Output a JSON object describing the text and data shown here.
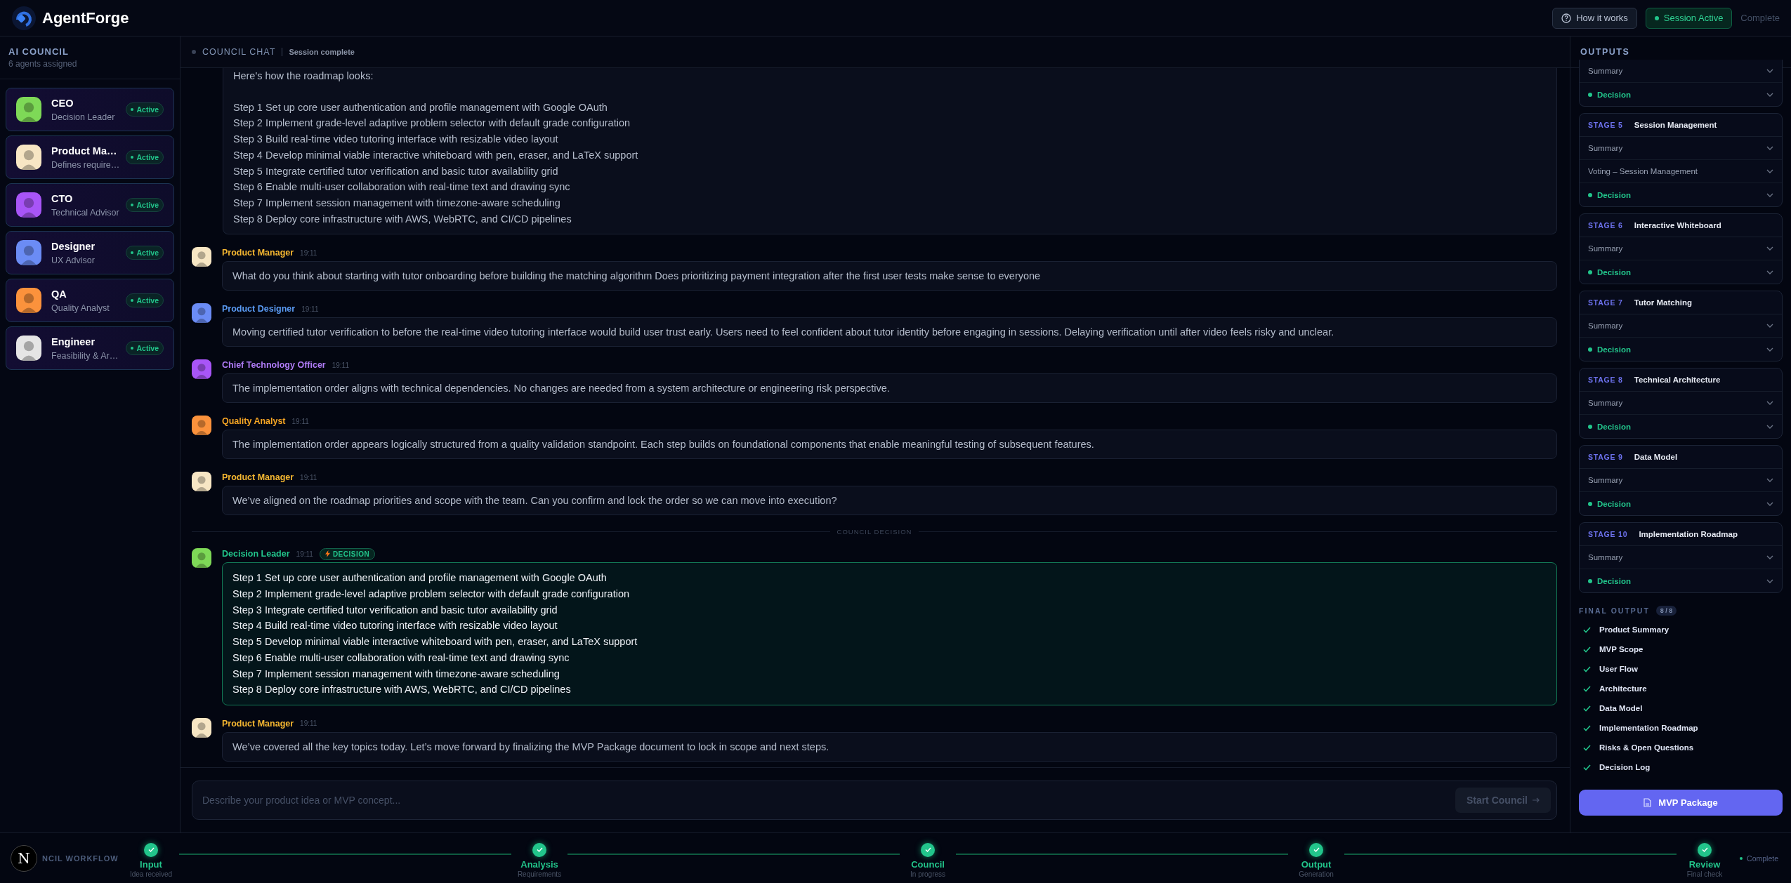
{
  "header": {
    "brand": "AgentForge",
    "help_button": "How it works",
    "session_badge": "Session Active",
    "status": "Complete"
  },
  "sidebar": {
    "title": "AI COUNCIL",
    "subtitle": "6 agents assigned",
    "agents": [
      {
        "name": "CEO",
        "role": "Decision Leader",
        "status": "Active",
        "color": "#7ed957"
      },
      {
        "name": "Product Ma…",
        "role": "Defines require…",
        "status": "Active",
        "color": "#f7e6c4"
      },
      {
        "name": "CTO",
        "role": "Technical Advisor",
        "status": "Active",
        "color": "#a855f7"
      },
      {
        "name": "Designer",
        "role": "UX Advisor",
        "status": "Active",
        "color": "#6b8cf5"
      },
      {
        "name": "QA",
        "role": "Quality Analyst",
        "status": "Active",
        "color": "#fb923c"
      },
      {
        "name": "Engineer",
        "role": "Feasibility & Ar…",
        "status": "Active",
        "color": "#e5e5e5"
      }
    ]
  },
  "chat": {
    "title": "COUNCIL CHAT",
    "status": "Session complete",
    "messages": [
      {
        "kind": "continuation",
        "intro": "Here's how the roadmap looks:",
        "steps": [
          "Step 1 Set up core user authentication and profile management with Google OAuth",
          "Step 2 Implement grade-level adaptive problem selector with default grade configuration",
          "Step 3 Build real-time video tutoring interface with resizable video layout",
          "Step 4 Develop minimal viable interactive whiteboard with pen, eraser, and LaTeX support",
          "Step 5 Integrate certified tutor verification and basic tutor availability grid",
          "Step 6 Enable multi-user collaboration with real-time text and drawing sync",
          "Step 7 Implement session management with timezone-aware scheduling",
          "Step 8 Deploy core infrastructure with AWS, WebRTC, and CI/CD pipelines"
        ]
      },
      {
        "kind": "message",
        "author": "Product Manager",
        "color": "#f5b731",
        "avatar": {
          "color": "#f7e6c4"
        },
        "time": "19:11",
        "text": "What do you think about starting with tutor onboarding before building the matching algorithm Does prioritizing payment integration after the first user tests make sense to everyone"
      },
      {
        "kind": "message",
        "author": "Product Designer",
        "color": "#5b9cf5",
        "avatar": {
          "color": "#6b8cf5"
        },
        "time": "19:11",
        "text": "Moving certified tutor verification to before the real-time video tutoring interface would build user trust early. Users need to feel confident about tutor identity before engaging in sessions. Delaying verification until after video feels risky and unclear."
      },
      {
        "kind": "message",
        "author": "Chief Technology Officer",
        "color": "#b07cf7",
        "avatar": {
          "color": "#a855f7"
        },
        "time": "19:11",
        "text": "The implementation order aligns with technical dependencies. No changes are needed from a system architecture or engineering risk perspective."
      },
      {
        "kind": "message",
        "author": "Quality Analyst",
        "color": "#f5a524",
        "avatar": {
          "color": "#fb923c"
        },
        "time": "19:11",
        "text": "The implementation order appears logically structured from a quality validation standpoint. Each step builds on foundational components that enable meaningful testing of subsequent features."
      },
      {
        "kind": "message",
        "author": "Product Manager",
        "color": "#f5b731",
        "avatar": {
          "color": "#f7e6c4"
        },
        "time": "19:11",
        "text": "We’ve aligned on the roadmap priorities and scope with the team. Can you confirm and lock the order so we can move into execution?"
      },
      {
        "kind": "divider",
        "label": "COUNCIL DECISION"
      },
      {
        "kind": "decision",
        "author": "Decision Leader",
        "color": "#22c58b",
        "avatar": {
          "color": "#7ed957"
        },
        "time": "19:11",
        "badge": "DECISION",
        "steps": [
          "Step 1 Set up core user authentication and profile management with Google OAuth",
          "Step 2 Implement grade-level adaptive problem selector with default grade configuration",
          "Step 3 Integrate certified tutor verification and basic tutor availability grid",
          "Step 4 Build real-time video tutoring interface with resizable video layout",
          "Step 5 Develop minimal viable interactive whiteboard with pen, eraser, and LaTeX support",
          "Step 6 Enable multi-user collaboration with real-time text and drawing sync",
          "Step 7 Implement session management with timezone-aware scheduling",
          "Step 8 Deploy core infrastructure with AWS, WebRTC, and CI/CD pipelines"
        ]
      },
      {
        "kind": "message",
        "author": "Product Manager",
        "color": "#f5b731",
        "avatar": {
          "color": "#f7e6c4"
        },
        "time": "19:11",
        "text": "We’ve covered all the key topics today. Let’s move forward by finalizing the MVP Package document to lock in scope and next steps."
      }
    ],
    "input": {
      "placeholder": "Describe your product idea or MVP concept...",
      "button": "Start Council",
      "disabled": true
    }
  },
  "outputs": {
    "title": "OUTPUTS",
    "stages": [
      {
        "rows": [
          {
            "kind": "summary",
            "text": "Summary"
          },
          {
            "kind": "decision",
            "text": "Decision"
          }
        ]
      },
      {
        "label": "STAGE 5",
        "title": "Session Management",
        "rows": [
          {
            "kind": "summary",
            "text": "Summary"
          },
          {
            "kind": "summary",
            "text": "Voting – Session Management"
          },
          {
            "kind": "decision",
            "text": "Decision"
          }
        ]
      },
      {
        "label": "STAGE 6",
        "title": "Interactive Whiteboard",
        "rows": [
          {
            "kind": "summary",
            "text": "Summary"
          },
          {
            "kind": "decision",
            "text": "Decision"
          }
        ]
      },
      {
        "label": "STAGE 7",
        "title": "Tutor Matching",
        "rows": [
          {
            "kind": "summary",
            "text": "Summary"
          },
          {
            "kind": "decision",
            "text": "Decision"
          }
        ]
      },
      {
        "label": "STAGE 8",
        "title": "Technical Architecture",
        "rows": [
          {
            "kind": "summary",
            "text": "Summary"
          },
          {
            "kind": "decision",
            "text": "Decision"
          }
        ]
      },
      {
        "label": "STAGE 9",
        "title": "Data Model",
        "rows": [
          {
            "kind": "summary",
            "text": "Summary"
          },
          {
            "kind": "decision",
            "text": "Decision"
          }
        ]
      },
      {
        "label": "STAGE 10",
        "title": "Implementation Roadmap",
        "rows": [
          {
            "kind": "summary",
            "text": "Summary"
          },
          {
            "kind": "decision",
            "text": "Decision"
          }
        ]
      }
    ],
    "final_output": {
      "title": "FINAL OUTPUT",
      "count": "8 / 8",
      "items": [
        {
          "text": "Product Summary",
          "checked": true
        },
        {
          "text": "MVP Scope",
          "checked": true
        },
        {
          "text": "User Flow",
          "checked": true
        },
        {
          "text": "Architecture",
          "checked": true
        },
        {
          "text": "Data Model",
          "checked": true
        },
        {
          "text": "Implementation Roadmap",
          "checked": true
        },
        {
          "text": "Risks & Open Questions",
          "checked": true
        },
        {
          "text": "Decision Log",
          "checked": true
        }
      ],
      "button": "MVP Package"
    }
  },
  "workflow": {
    "dev_badge": "N",
    "label": "NCIL WORKFLOW",
    "steps": [
      {
        "title": "Input",
        "subtitle": "Idea received",
        "done": true
      },
      {
        "title": "Analysis",
        "subtitle": "Requirements",
        "done": true
      },
      {
        "title": "Council",
        "subtitle": "In progress",
        "done": true
      },
      {
        "title": "Output",
        "subtitle": "Generation",
        "done": true
      },
      {
        "title": "Review",
        "subtitle": "Final check",
        "done": true
      }
    ],
    "status": "Complete"
  }
}
